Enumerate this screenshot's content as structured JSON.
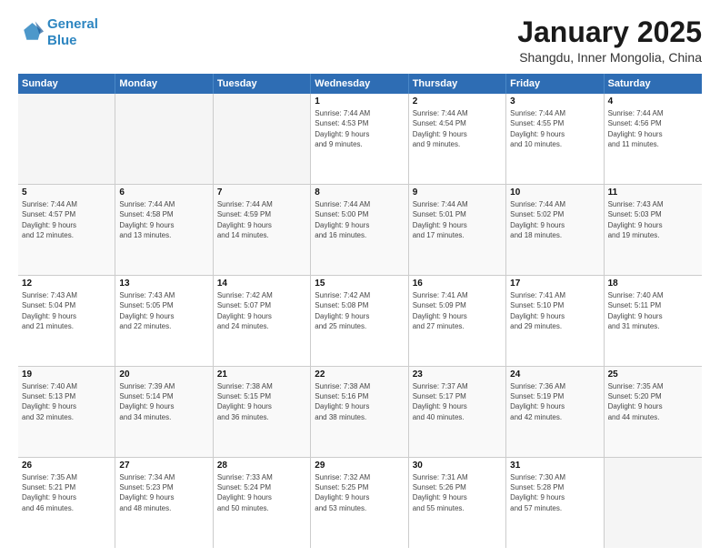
{
  "logo": {
    "line1": "General",
    "line2": "Blue"
  },
  "title": "January 2025",
  "subtitle": "Shangdu, Inner Mongolia, China",
  "headers": [
    "Sunday",
    "Monday",
    "Tuesday",
    "Wednesday",
    "Thursday",
    "Friday",
    "Saturday"
  ],
  "weeks": [
    [
      {
        "day": "",
        "detail": ""
      },
      {
        "day": "",
        "detail": ""
      },
      {
        "day": "",
        "detail": ""
      },
      {
        "day": "1",
        "detail": "Sunrise: 7:44 AM\nSunset: 4:53 PM\nDaylight: 9 hours\nand 9 minutes."
      },
      {
        "day": "2",
        "detail": "Sunrise: 7:44 AM\nSunset: 4:54 PM\nDaylight: 9 hours\nand 9 minutes."
      },
      {
        "day": "3",
        "detail": "Sunrise: 7:44 AM\nSunset: 4:55 PM\nDaylight: 9 hours\nand 10 minutes."
      },
      {
        "day": "4",
        "detail": "Sunrise: 7:44 AM\nSunset: 4:56 PM\nDaylight: 9 hours\nand 11 minutes."
      }
    ],
    [
      {
        "day": "5",
        "detail": "Sunrise: 7:44 AM\nSunset: 4:57 PM\nDaylight: 9 hours\nand 12 minutes."
      },
      {
        "day": "6",
        "detail": "Sunrise: 7:44 AM\nSunset: 4:58 PM\nDaylight: 9 hours\nand 13 minutes."
      },
      {
        "day": "7",
        "detail": "Sunrise: 7:44 AM\nSunset: 4:59 PM\nDaylight: 9 hours\nand 14 minutes."
      },
      {
        "day": "8",
        "detail": "Sunrise: 7:44 AM\nSunset: 5:00 PM\nDaylight: 9 hours\nand 16 minutes."
      },
      {
        "day": "9",
        "detail": "Sunrise: 7:44 AM\nSunset: 5:01 PM\nDaylight: 9 hours\nand 17 minutes."
      },
      {
        "day": "10",
        "detail": "Sunrise: 7:44 AM\nSunset: 5:02 PM\nDaylight: 9 hours\nand 18 minutes."
      },
      {
        "day": "11",
        "detail": "Sunrise: 7:43 AM\nSunset: 5:03 PM\nDaylight: 9 hours\nand 19 minutes."
      }
    ],
    [
      {
        "day": "12",
        "detail": "Sunrise: 7:43 AM\nSunset: 5:04 PM\nDaylight: 9 hours\nand 21 minutes."
      },
      {
        "day": "13",
        "detail": "Sunrise: 7:43 AM\nSunset: 5:05 PM\nDaylight: 9 hours\nand 22 minutes."
      },
      {
        "day": "14",
        "detail": "Sunrise: 7:42 AM\nSunset: 5:07 PM\nDaylight: 9 hours\nand 24 minutes."
      },
      {
        "day": "15",
        "detail": "Sunrise: 7:42 AM\nSunset: 5:08 PM\nDaylight: 9 hours\nand 25 minutes."
      },
      {
        "day": "16",
        "detail": "Sunrise: 7:41 AM\nSunset: 5:09 PM\nDaylight: 9 hours\nand 27 minutes."
      },
      {
        "day": "17",
        "detail": "Sunrise: 7:41 AM\nSunset: 5:10 PM\nDaylight: 9 hours\nand 29 minutes."
      },
      {
        "day": "18",
        "detail": "Sunrise: 7:40 AM\nSunset: 5:11 PM\nDaylight: 9 hours\nand 31 minutes."
      }
    ],
    [
      {
        "day": "19",
        "detail": "Sunrise: 7:40 AM\nSunset: 5:13 PM\nDaylight: 9 hours\nand 32 minutes."
      },
      {
        "day": "20",
        "detail": "Sunrise: 7:39 AM\nSunset: 5:14 PM\nDaylight: 9 hours\nand 34 minutes."
      },
      {
        "day": "21",
        "detail": "Sunrise: 7:38 AM\nSunset: 5:15 PM\nDaylight: 9 hours\nand 36 minutes."
      },
      {
        "day": "22",
        "detail": "Sunrise: 7:38 AM\nSunset: 5:16 PM\nDaylight: 9 hours\nand 38 minutes."
      },
      {
        "day": "23",
        "detail": "Sunrise: 7:37 AM\nSunset: 5:17 PM\nDaylight: 9 hours\nand 40 minutes."
      },
      {
        "day": "24",
        "detail": "Sunrise: 7:36 AM\nSunset: 5:19 PM\nDaylight: 9 hours\nand 42 minutes."
      },
      {
        "day": "25",
        "detail": "Sunrise: 7:35 AM\nSunset: 5:20 PM\nDaylight: 9 hours\nand 44 minutes."
      }
    ],
    [
      {
        "day": "26",
        "detail": "Sunrise: 7:35 AM\nSunset: 5:21 PM\nDaylight: 9 hours\nand 46 minutes."
      },
      {
        "day": "27",
        "detail": "Sunrise: 7:34 AM\nSunset: 5:23 PM\nDaylight: 9 hours\nand 48 minutes."
      },
      {
        "day": "28",
        "detail": "Sunrise: 7:33 AM\nSunset: 5:24 PM\nDaylight: 9 hours\nand 50 minutes."
      },
      {
        "day": "29",
        "detail": "Sunrise: 7:32 AM\nSunset: 5:25 PM\nDaylight: 9 hours\nand 53 minutes."
      },
      {
        "day": "30",
        "detail": "Sunrise: 7:31 AM\nSunset: 5:26 PM\nDaylight: 9 hours\nand 55 minutes."
      },
      {
        "day": "31",
        "detail": "Sunrise: 7:30 AM\nSunset: 5:28 PM\nDaylight: 9 hours\nand 57 minutes."
      },
      {
        "day": "",
        "detail": ""
      }
    ]
  ]
}
